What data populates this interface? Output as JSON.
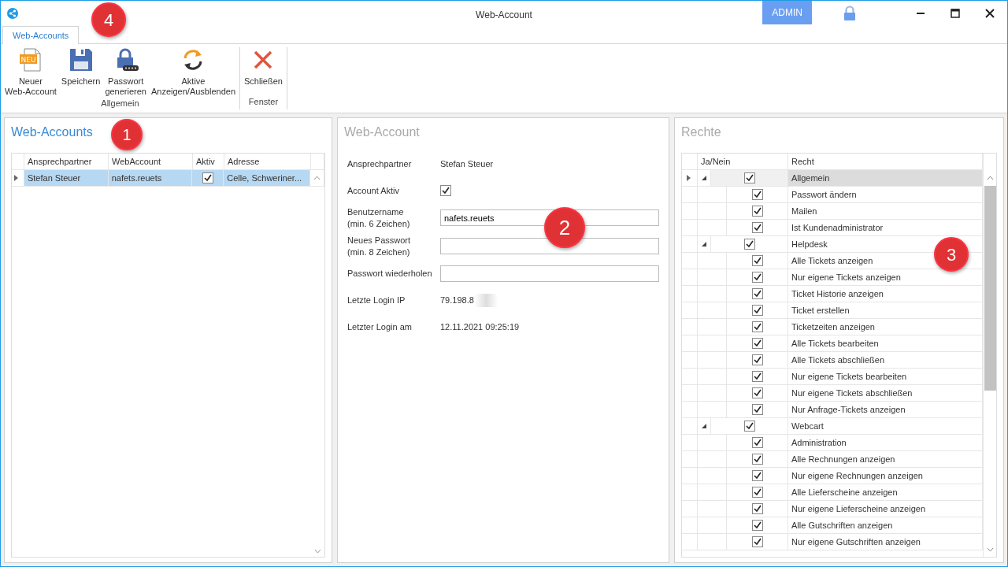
{
  "window": {
    "title": "Web-Account",
    "user_badge": "ADMIN"
  },
  "ribbon": {
    "tabs": [
      {
        "label": "Web-Accounts",
        "selected": true
      }
    ],
    "groups": [
      {
        "label": "Allgemein",
        "buttons": [
          {
            "kind": "new",
            "label": "Neuer Web-Account",
            "icon_text": "NEU"
          },
          {
            "kind": "save",
            "label": "Speichern"
          },
          {
            "kind": "password",
            "label": "Passwort generieren"
          },
          {
            "kind": "toggle",
            "label": "Aktive Anzeigen/Ausblenden"
          }
        ]
      },
      {
        "label": "Fenster",
        "buttons": [
          {
            "kind": "close",
            "label": "Schließen"
          }
        ]
      }
    ]
  },
  "accounts": {
    "title": "Web-Accounts",
    "columns": [
      "Ansprechpartner",
      "WebAccount",
      "Aktiv",
      "Adresse"
    ],
    "rows": [
      {
        "contact": "Stefan Steuer",
        "account": "nafets.reuets",
        "active": true,
        "address": "Celle, Schweriner...",
        "selected": true
      }
    ]
  },
  "detail": {
    "title": "Web-Account",
    "fields": [
      {
        "kind": "text",
        "label": "Ansprechpartner",
        "value": "Stefan Steuer"
      },
      {
        "kind": "checkbox",
        "label": "Account Aktiv",
        "checked": true
      },
      {
        "kind": "input",
        "label": "Benutzername\n(min. 6 Zeichen)",
        "value": "nafets.reuets"
      },
      {
        "kind": "input",
        "label": "Neues Passwort\n(min. 8 Zeichen)"
      },
      {
        "kind": "input",
        "label": "Passwort wiederholen"
      },
      {
        "kind": "text",
        "label": "Letzte Login IP",
        "value": "79.198.8",
        "blurred": true
      },
      {
        "kind": "text",
        "label": "Letzter Login am",
        "value": "12.11.2021 09:25:19"
      }
    ]
  },
  "rights": {
    "title": "Rechte",
    "columns": [
      "Ja/Nein",
      "Recht"
    ],
    "groups": [
      {
        "label": "Allgemein",
        "checked": true,
        "expanded": true,
        "selected": true,
        "children": [
          {
            "label": "Passwort ändern",
            "checked": true
          },
          {
            "label": "Mailen",
            "checked": true
          },
          {
            "label": "Ist Kundenadministrator",
            "checked": true
          }
        ]
      },
      {
        "label": "Helpdesk",
        "checked": true,
        "expanded": true,
        "selected": false,
        "children": [
          {
            "label": "Alle Tickets anzeigen",
            "checked": true
          },
          {
            "label": "Nur eigene Tickets anzeigen",
            "checked": true
          },
          {
            "label": "Ticket Historie anzeigen",
            "checked": true
          },
          {
            "label": "Ticket erstellen",
            "checked": true
          },
          {
            "label": "Ticketzeiten anzeigen",
            "checked": true
          },
          {
            "label": "Alle Tickets bearbeiten",
            "checked": true
          },
          {
            "label": "Alle Tickets abschließen",
            "checked": true
          },
          {
            "label": "Nur eigene Tickets bearbeiten",
            "checked": true
          },
          {
            "label": "Nur eigene Tickets abschließen",
            "checked": true
          },
          {
            "label": "Nur Anfrage-Tickets anzeigen",
            "checked": true
          }
        ]
      },
      {
        "label": "Webcart",
        "checked": true,
        "expanded": true,
        "selected": false,
        "children": [
          {
            "label": "Administration",
            "checked": true
          },
          {
            "label": "Alle Rechnungen anzeigen",
            "checked": true
          },
          {
            "label": "Nur eigene Rechnungen anzeigen",
            "checked": true
          },
          {
            "label": "Alle Lieferscheine anzeigen",
            "checked": true
          },
          {
            "label": "Nur eigene Lieferscheine anzeigen",
            "checked": true
          },
          {
            "label": "Alle Gutschriften anzeigen",
            "checked": true
          },
          {
            "label": "Nur eigene Gutschriften anzeigen",
            "checked": true
          }
        ]
      }
    ]
  },
  "callouts": [
    "1",
    "2",
    "3",
    "4"
  ]
}
